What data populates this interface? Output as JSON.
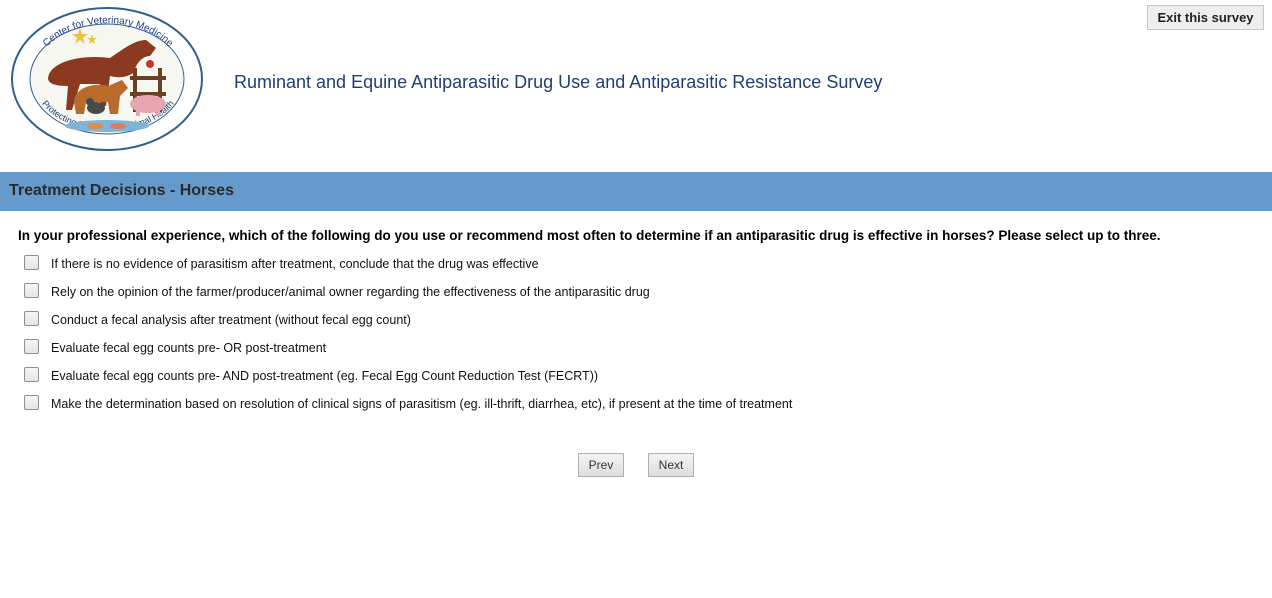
{
  "header": {
    "logo": {
      "top_text": "Center for Veterinary Medicine",
      "bottom_text": "Protecting Human and Animal Health"
    },
    "survey_title": "Ruminant and Equine Antiparasitic Drug Use and Antiparasitic Resistance Survey",
    "exit_label": "Exit this survey"
  },
  "section": {
    "title": "Treatment Decisions - Horses",
    "banner_color": "#6699cc"
  },
  "question": {
    "text": "In your professional experience, which of the following do you use or recommend most often to determine if an antiparasitic drug is effective in horses? Please select up to three.",
    "options": [
      {
        "label": "If there is no evidence of parasitism after treatment, conclude that the drug was effective",
        "checked": false
      },
      {
        "label": "Rely on the opinion of the farmer/producer/animal owner regarding the effectiveness of the antiparasitic drug",
        "checked": false
      },
      {
        "label": "Conduct a fecal analysis after treatment (without fecal egg count)",
        "checked": false
      },
      {
        "label": "Evaluate fecal egg counts pre- OR post-treatment",
        "checked": false
      },
      {
        "label": "Evaluate fecal egg counts pre- AND post-treatment (eg. Fecal Egg Count Reduction Test (FECRT))",
        "checked": false
      },
      {
        "label": "Make the determination based on resolution of clinical signs of parasitism (eg. ill-thrift, diarrhea, etc), if present at the time of treatment",
        "checked": false
      }
    ]
  },
  "nav": {
    "prev_label": "Prev",
    "next_label": "Next"
  }
}
